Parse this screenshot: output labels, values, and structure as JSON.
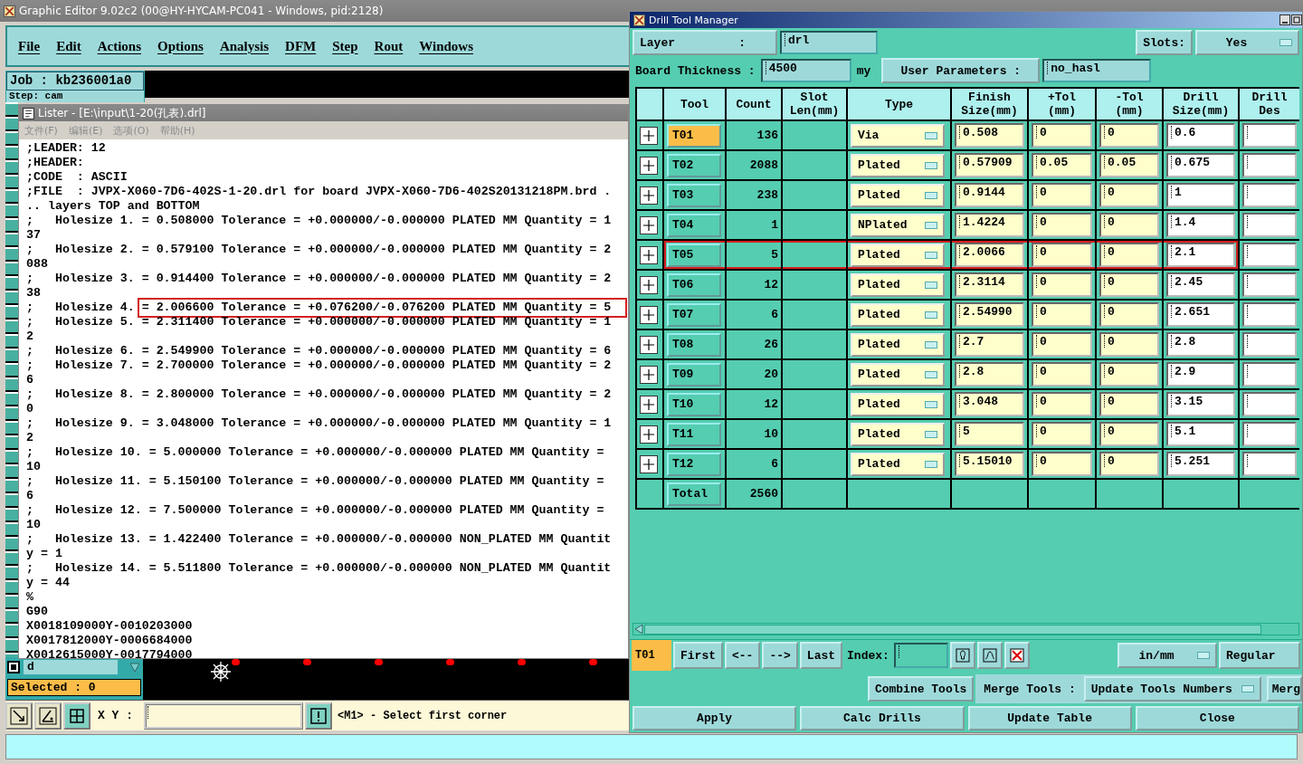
{
  "editor": {
    "title": "Graphic Editor 9.02c2 (00@HY-HYCAM-PC041 - Windows, pid:2128)",
    "menu": [
      "File",
      "Edit",
      "Actions",
      "Options",
      "Analysis",
      "DFM",
      "Step",
      "Rout",
      "Windows"
    ],
    "job": "Job : kb236001a0",
    "step": "Step: cam",
    "layer_field": "d",
    "selected": "Selected : 0",
    "coord_label": "X Y :",
    "status": "<M1> - Select first corner"
  },
  "lister": {
    "title": "Lister - [E:\\input\\1-20(孔表).drl]",
    "menu": [
      "文件(F)",
      "编辑(E)",
      "选项(O)",
      "帮助(H)"
    ],
    "lines": [
      {
        "text": ";LEADER: 12"
      },
      {
        "text": ";HEADER:"
      },
      {
        "text": ";CODE  : ASCII"
      },
      {
        "text": ";FILE  : JVPX-X060-7D6-402S-1-20.drl for board JVPX-X060-7D6-402S20131218PM.brd ."
      },
      {
        "text": ".. layers TOP and BOTTOM"
      },
      {
        "text": ";   Holesize 1. = 0.508000 Tolerance = +0.000000/-0.000000 PLATED MM Quantity = 1"
      },
      {
        "text": "37"
      },
      {
        "text": ";   Holesize 2. = 0.579100 Tolerance = +0.000000/-0.000000 PLATED MM Quantity = 2"
      },
      {
        "text": "088"
      },
      {
        "text": ";   Holesize 3. = 0.914400 Tolerance = +0.000000/-0.000000 PLATED MM Quantity = 2"
      },
      {
        "text": "38"
      },
      {
        "text": ";   Holesize 4. ",
        "highlight": "= 2.006600 Tolerance = +0.076200/-0.076200 PLATED MM Quantity = 5"
      },
      {
        "text": ";   Holesize 5. = 2.311400 Tolerance = +0.000000/-0.000000 PLATED MM Quantity = 1"
      },
      {
        "text": "2"
      },
      {
        "text": ";   Holesize 6. = 2.549900 Tolerance = +0.000000/-0.000000 PLATED MM Quantity = 6"
      },
      {
        "text": ";   Holesize 7. = 2.700000 Tolerance = +0.000000/-0.000000 PLATED MM Quantity = 2"
      },
      {
        "text": "6"
      },
      {
        "text": ";   Holesize 8. = 2.800000 Tolerance = +0.000000/-0.000000 PLATED MM Quantity = 2"
      },
      {
        "text": "0"
      },
      {
        "text": ";   Holesize 9. = 3.048000 Tolerance = +0.000000/-0.000000 PLATED MM Quantity = 1"
      },
      {
        "text": "2"
      },
      {
        "text": ";   Holesize 10. = 5.000000 Tolerance = +0.000000/-0.000000 PLATED MM Quantity ="
      },
      {
        "text": "10"
      },
      {
        "text": ";   Holesize 11. = 5.150100 Tolerance = +0.000000/-0.000000 PLATED MM Quantity ="
      },
      {
        "text": "6"
      },
      {
        "text": ";   Holesize 12. = 7.500000 Tolerance = +0.000000/-0.000000 PLATED MM Quantity ="
      },
      {
        "text": "10"
      },
      {
        "text": ";   Holesize 13. = 1.422400 Tolerance = +0.000000/-0.000000 NON_PLATED MM Quantit"
      },
      {
        "text": "y = 1"
      },
      {
        "text": ";   Holesize 14. = 5.511800 Tolerance = +0.000000/-0.000000 NON_PLATED MM Quantit"
      },
      {
        "text": "y = 44"
      },
      {
        "text": "%"
      },
      {
        "text": "G90"
      },
      {
        "text": "X0018109000Y-0010203000"
      },
      {
        "text": "X0017812000Y-0006684000"
      },
      {
        "text": "X0012615000Y-0017794000"
      }
    ]
  },
  "drill_tool_manager": {
    "title": "Drill Tool Manager",
    "layer_label": "Layer         :",
    "layer": "drl",
    "slots_label": "Slots:",
    "slots": "Yes",
    "thickness_label": "Board Thickness :",
    "thickness": "4500",
    "thickness_unit": "my",
    "user_params_label": "User Parameters :",
    "user_params": "no_hasl",
    "columns": [
      "Tool",
      "Count",
      "Slot\nLen(mm)",
      "Type",
      "Finish\nSize(mm)",
      "+Tol\n(mm)",
      "-Tol\n(mm)",
      "Drill\nSize(mm)",
      "Drill\nDes"
    ],
    "rows": [
      {
        "tool": "T01",
        "count": "136",
        "type": "Via",
        "finish": "0.508",
        "plus_tol": "0",
        "minus_tol": "0",
        "drill_size": "0.6",
        "selected": true,
        "highlighted": false
      },
      {
        "tool": "T02",
        "count": "2088",
        "type": "Plated",
        "finish": "0.57909",
        "plus_tol": "0.05",
        "minus_tol": "0.05",
        "drill_size": "0.675",
        "selected": false,
        "highlighted": false
      },
      {
        "tool": "T03",
        "count": "238",
        "type": "Plated",
        "finish": "0.9144",
        "plus_tol": "0",
        "minus_tol": "0",
        "drill_size": "1",
        "selected": false,
        "highlighted": false
      },
      {
        "tool": "T04",
        "count": "1",
        "type": "NPlated",
        "finish": "1.4224",
        "plus_tol": "0",
        "minus_tol": "0",
        "drill_size": "1.4",
        "selected": false,
        "highlighted": false
      },
      {
        "tool": "T05",
        "count": "5",
        "type": "Plated",
        "finish": "2.0066",
        "plus_tol": "0",
        "minus_tol": "0",
        "drill_size": "2.1",
        "selected": false,
        "highlighted": true
      },
      {
        "tool": "T06",
        "count": "12",
        "type": "Plated",
        "finish": "2.3114",
        "plus_tol": "0",
        "minus_tol": "0",
        "drill_size": "2.45",
        "selected": false,
        "highlighted": false
      },
      {
        "tool": "T07",
        "count": "6",
        "type": "Plated",
        "finish": "2.54990",
        "plus_tol": "0",
        "minus_tol": "0",
        "drill_size": "2.651",
        "selected": false,
        "highlighted": false
      },
      {
        "tool": "T08",
        "count": "26",
        "type": "Plated",
        "finish": "2.7",
        "plus_tol": "0",
        "minus_tol": "0",
        "drill_size": "2.8",
        "selected": false,
        "highlighted": false
      },
      {
        "tool": "T09",
        "count": "20",
        "type": "Plated",
        "finish": "2.8",
        "plus_tol": "0",
        "minus_tol": "0",
        "drill_size": "2.9",
        "selected": false,
        "highlighted": false
      },
      {
        "tool": "T10",
        "count": "12",
        "type": "Plated",
        "finish": "3.048",
        "plus_tol": "0",
        "minus_tol": "0",
        "drill_size": "3.15",
        "selected": false,
        "highlighted": false
      },
      {
        "tool": "T11",
        "count": "10",
        "type": "Plated",
        "finish": "5",
        "plus_tol": "0",
        "minus_tol": "0",
        "drill_size": "5.1",
        "selected": false,
        "highlighted": false
      },
      {
        "tool": "T12",
        "count": "6",
        "type": "Plated",
        "finish": "5.15010",
        "plus_tol": "0",
        "minus_tol": "0",
        "drill_size": "5.251",
        "selected": false,
        "highlighted": false
      }
    ],
    "total": {
      "label": "Total",
      "count": "2560"
    },
    "nav": {
      "current": "T01",
      "buttons": [
        "First",
        "<--",
        "-->",
        "Last"
      ],
      "index_label": "Index:",
      "units": "in/mm",
      "mode": "Regular"
    },
    "combine": "Combine Tools",
    "merge_label": "Merge Tools :",
    "merge_option": "Update Tools Numbers",
    "merge_cut": "Merg",
    "footer_buttons": [
      "Apply",
      "Calc Drills",
      "Update Table",
      "Close"
    ]
  }
}
